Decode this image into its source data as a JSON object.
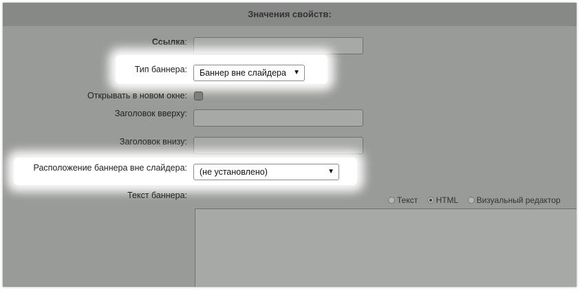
{
  "header": {
    "title": "Значения свойств:"
  },
  "fields": {
    "link_label": "Ссылка",
    "banner_type_label": "Тип баннера:",
    "banner_type_value": "Баннер вне слайдера",
    "new_window_label": "Открывать в новом окне:",
    "title_top_label": "Заголовок вверху:",
    "title_bottom_label": "Заголовок внизу:",
    "placement_label": "Расположение баннера вне слайдера:",
    "placement_value": "(не установлено)",
    "banner_text_label": "Текст баннера:"
  },
  "editor_modes": {
    "text": "Текст",
    "html": "HTML",
    "visual": "Визуальный редактор",
    "selected": "HTML"
  },
  "icons": {
    "dropdown": "dropdown-arrow-icon"
  },
  "colors": {
    "overlay": "#999b98",
    "header": "#878987",
    "highlight": "#ffffff"
  }
}
